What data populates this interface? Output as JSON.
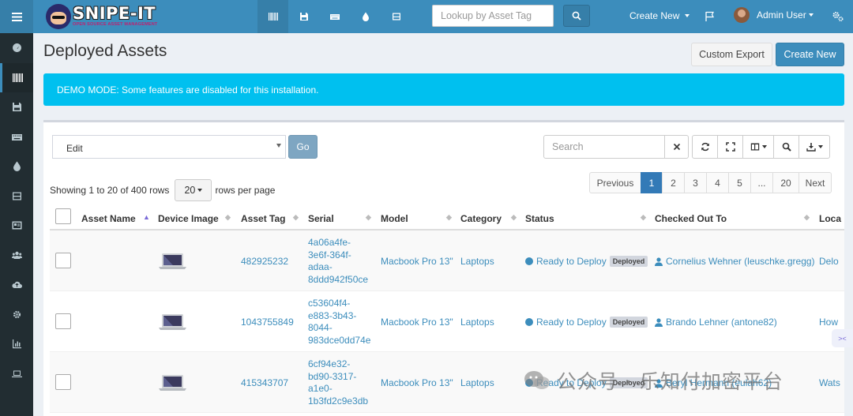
{
  "app": {
    "brand": "SNIPE-IT",
    "tagline": "OPEN SOURCE ASSET MANAGEMENT"
  },
  "topnav": {
    "icons": [
      "barcode-icon",
      "hdd-icon",
      "keyboard-icon",
      "droplet-icon",
      "server-icon"
    ],
    "tag_search_placeholder": "Lookup by Asset Tag",
    "create_new": "Create New",
    "user": "Admin User"
  },
  "sidebar": {
    "items": [
      "dashboard-icon",
      "barcode-icon",
      "hdd-icon",
      "keyboard-icon",
      "droplet-icon",
      "server-icon",
      "id-card-icon",
      "users-icon",
      "cloud-upload-icon",
      "settings-icon",
      "reports-icon",
      "laptop-icon"
    ],
    "active_index": 1
  },
  "page": {
    "title": "Deployed Assets",
    "custom_export": "Custom Export",
    "create_new": "Create New",
    "alert": "DEMO MODE: Some features are disabled for this installation."
  },
  "toolbar": {
    "bulk_action": "Edit",
    "go": "Go",
    "search_placeholder": "Search"
  },
  "pagination": {
    "showing": "Showing 1 to 20 of 400 rows",
    "per_page": "20",
    "per_page_suffix": "rows per page",
    "pages": [
      "Previous",
      "1",
      "2",
      "3",
      "4",
      "5",
      "...",
      "20",
      "Next"
    ],
    "active": "1"
  },
  "table": {
    "columns": [
      "Asset Name",
      "Device Image",
      "Asset Tag",
      "Serial",
      "Model",
      "Category",
      "Status",
      "Checked Out To",
      "Loca"
    ],
    "rows": [
      {
        "asset_tag": "482925232",
        "serial": [
          "4a06a4fe-",
          "3e6f-364f-",
          "adaa-",
          "8ddd942f50ce"
        ],
        "model": "Macbook Pro 13\"",
        "category": "Laptops",
        "status": "Ready to Deploy",
        "status_badge": "Deployed",
        "checked_out_to": "Cornelius Wehner (leuschke.gregg)",
        "location": "Delo"
      },
      {
        "asset_tag": "1043755849",
        "serial": [
          "c53604f4-",
          "e883-3b43-",
          "8044-",
          "983dce0dd74e"
        ],
        "model": "Macbook Pro 13\"",
        "category": "Laptops",
        "status": "Ready to Deploy",
        "status_badge": "Deployed",
        "checked_out_to": "Brando Lehner (antone82)",
        "location": "How"
      },
      {
        "asset_tag": "415343707",
        "serial": [
          "6cf94e32-",
          "bd90-3317-",
          "a1e0-",
          "1b3fd2c9e3db"
        ],
        "model": "Macbook Pro 13\"",
        "category": "Laptops",
        "status": "Ready to Deploy",
        "status_badge": "Deployed",
        "checked_out_to": "Beryl Hermann (eulah62)",
        "location": "Wats"
      }
    ]
  },
  "watermark": "公众号 · 乐知付加密平台",
  "colors": {
    "header": "#3c8dbc",
    "sidebar": "#222d32",
    "alert": "#00c0ef",
    "primary": "#3c8dbc"
  }
}
